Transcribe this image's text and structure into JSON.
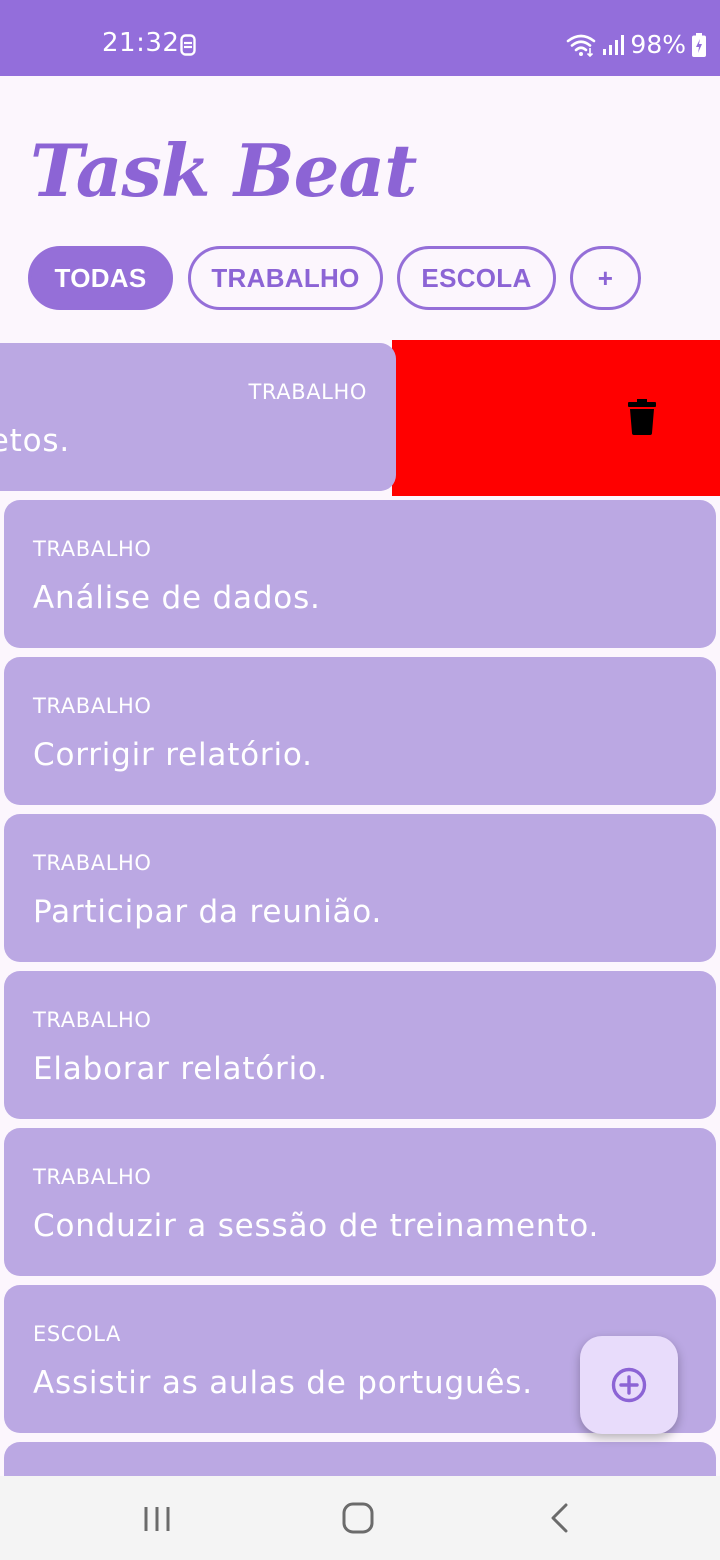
{
  "status_bar": {
    "time": "21:32",
    "battery": "98%",
    "background_color": "#936edb",
    "icons": [
      "sim-icon",
      "wifi-icon",
      "signal-icon",
      "battery-charging-icon"
    ]
  },
  "app": {
    "title": "Task Beat",
    "accent_color": "#8c64d5"
  },
  "filters": {
    "chips": [
      {
        "label": "TODAS",
        "active": true
      },
      {
        "label": "TRABALHO",
        "active": false
      },
      {
        "label": "ESCOLA",
        "active": false
      },
      {
        "label": "+",
        "active": false
      }
    ]
  },
  "swiped_task": {
    "category": "TRABALHO",
    "title": "Revisar projetos.",
    "delete_background_color": "#ff0000",
    "action_icon": "trash-icon"
  },
  "tasks": [
    {
      "category": "TRABALHO",
      "title": "Análise de dados."
    },
    {
      "category": "TRABALHO",
      "title": "Corrigir relatório."
    },
    {
      "category": "TRABALHO",
      "title": "Participar da reunião."
    },
    {
      "category": "TRABALHO",
      "title": "Elaborar relatório."
    },
    {
      "category": "TRABALHO",
      "title": "Conduzir a sessão de treinamento."
    },
    {
      "category": "ESCOLA",
      "title": "Assistir as aulas de português."
    },
    {
      "category": "",
      "title": ""
    }
  ],
  "card_color": "#bba8e3",
  "fab": {
    "icon": "add-circle-icon"
  },
  "nav_bar": {
    "icons": [
      "recents-icon",
      "home-icon",
      "back-icon"
    ]
  }
}
